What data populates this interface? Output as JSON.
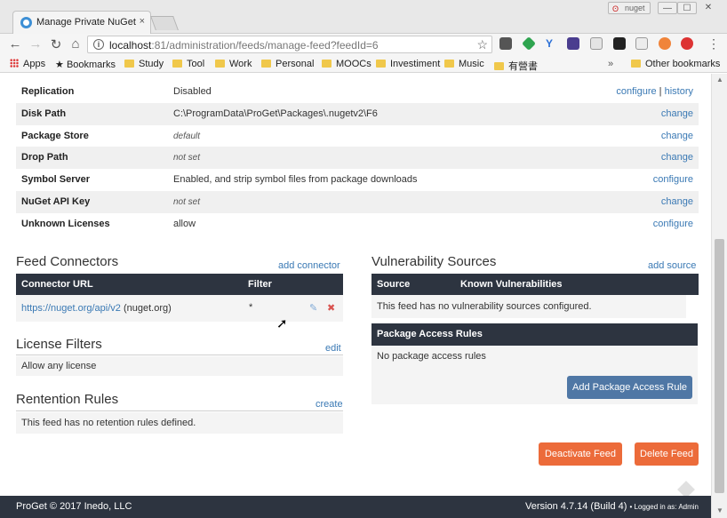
{
  "browser": {
    "tab_title": "Manage Private NuGet F",
    "tab_close": "×",
    "user_chip": "nuget",
    "window_buttons": [
      "—",
      "☐",
      "✕"
    ],
    "nav": {
      "back": "←",
      "forward": "→",
      "reload": "↻",
      "home": "⌂"
    },
    "url_host": "localhost",
    "url_path": ":81/administration/feeds/manage-feed?feedId=6",
    "info_glyph": "i",
    "star_glyph": "☆",
    "menu_glyph": "⋮",
    "bookmarks": [
      "Apps",
      "Bookmarks",
      "Study",
      "Tool",
      "Work",
      "Personal",
      "MOOCs",
      "Investiment",
      "Music",
      "有營書"
    ],
    "overflow": "»",
    "other_bookmarks": "Other bookmarks",
    "bookmark_star": "★"
  },
  "properties": [
    {
      "label": "Replication",
      "value": "Disabled",
      "italic": false,
      "actions": [
        "configure",
        "history"
      ]
    },
    {
      "label": "Disk Path",
      "value": "C:\\ProgramData\\ProGet\\Packages\\.nugetv2\\F6",
      "italic": false,
      "actions": [
        "change"
      ]
    },
    {
      "label": "Package Store",
      "value": "default",
      "italic": true,
      "actions": [
        "change"
      ]
    },
    {
      "label": "Drop Path",
      "value": "not set",
      "italic": true,
      "actions": [
        "change"
      ]
    },
    {
      "label": "Symbol Server",
      "value": "Enabled, and strip symbol files from package downloads",
      "italic": false,
      "actions": [
        "configure"
      ]
    },
    {
      "label": "NuGet API Key",
      "value": "not set",
      "italic": true,
      "actions": [
        "change"
      ]
    },
    {
      "label": "Unknown Licenses",
      "value": "allow",
      "italic": false,
      "actions": [
        "configure"
      ]
    }
  ],
  "action_separator": "|",
  "connectors": {
    "title": "Feed Connectors",
    "add_link": "add connector",
    "headers": [
      "Connector URL",
      "Filter"
    ],
    "rows": [
      {
        "url": "https://nuget.org/api/v2",
        "name": "(nuget.org)",
        "filter": "*"
      }
    ],
    "edit_glyph": "✎",
    "delete_glyph": "✖"
  },
  "license_filters": {
    "title": "License Filters",
    "edit_link": "edit",
    "text": "Allow any license"
  },
  "retention": {
    "title": "Rentention Rules",
    "create_link": "create",
    "text": "This feed has no retention rules defined."
  },
  "vulnerability": {
    "title": "Vulnerability Sources",
    "add_link": "add source",
    "headers": [
      "Source",
      "Known Vulnerabilities"
    ],
    "empty_text": "This feed has no vulnerability sources configured."
  },
  "access_rules": {
    "header": "Package Access Rules",
    "empty_text": "No package access rules",
    "add_button": "Add Package Access Rule"
  },
  "feed_actions": {
    "deactivate": "Deactivate Feed",
    "delete": "Delete Feed"
  },
  "footer": {
    "left": "ProGet © 2017 Inedo, LLC",
    "version": "Version 4.7.14 (Build 4)",
    "logged_in": "• Logged in as: Admin"
  },
  "colors": {
    "header_dark": "#2d3440",
    "link": "#3a79b4",
    "button_blue": "#4f77a5",
    "button_orange": "#ec6b3a"
  }
}
